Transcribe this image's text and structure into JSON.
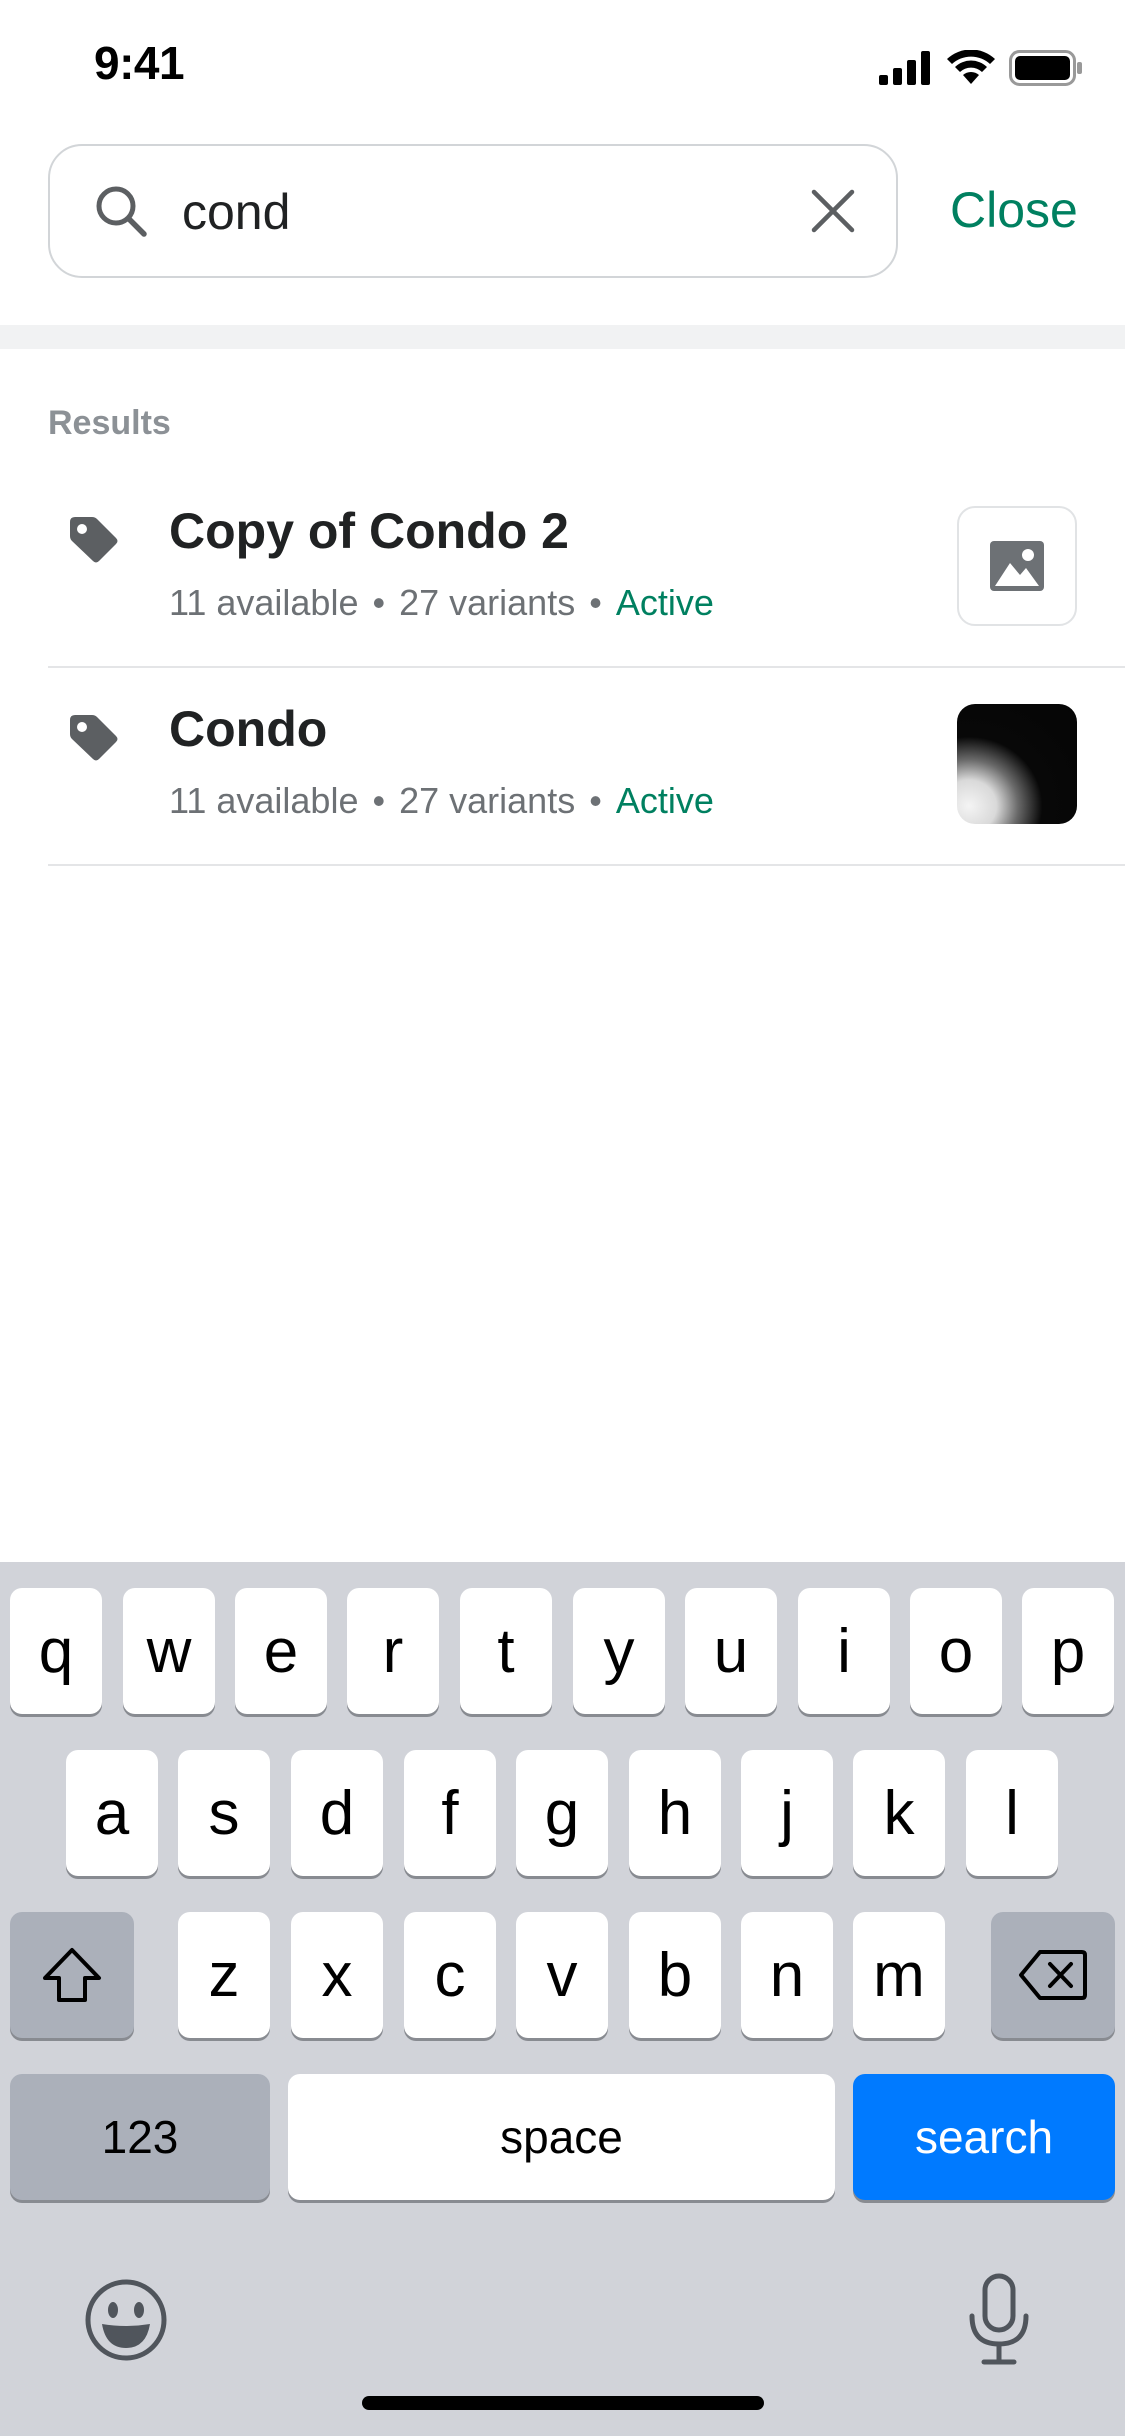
{
  "status_bar": {
    "time": "9:41"
  },
  "search": {
    "query": "cond",
    "close_label": "Close"
  },
  "results": {
    "section_label": "Results",
    "items": [
      {
        "title": "Copy of Condo 2",
        "available": "11 available",
        "variants": "27 variants",
        "status": "Active",
        "thumbnail": "image-placeholder-icon"
      },
      {
        "title": "Condo",
        "available": "11 available",
        "variants": "27 variants",
        "status": "Active",
        "thumbnail": "product-photo"
      }
    ],
    "separator": "•"
  },
  "keyboard": {
    "row1": [
      "q",
      "w",
      "e",
      "r",
      "t",
      "y",
      "u",
      "i",
      "o",
      "p"
    ],
    "row2": [
      "a",
      "s",
      "d",
      "f",
      "g",
      "h",
      "j",
      "k",
      "l"
    ],
    "row3": [
      "z",
      "x",
      "c",
      "v",
      "b",
      "n",
      "m"
    ],
    "numbers_label": "123",
    "space_label": "space",
    "search_label": "search"
  },
  "colors": {
    "accent": "#008060",
    "keyboard_blue": "#007aff"
  }
}
